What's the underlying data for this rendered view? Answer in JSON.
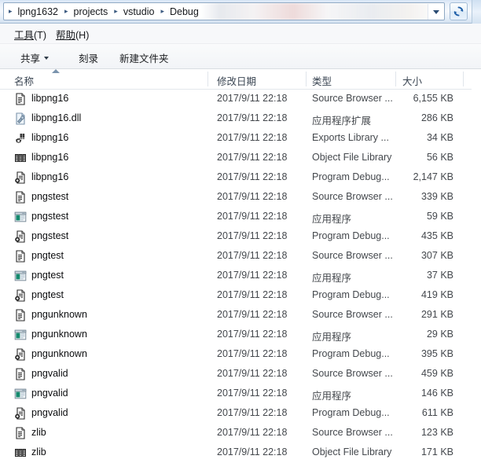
{
  "address_bar": {
    "breadcrumbs": [
      "lpng1632",
      "projects",
      "vstudio",
      "Debug"
    ],
    "separator_icon": "chevron-right-icon",
    "dropdown_icon": "chevron-down-icon",
    "refresh_icon": "refresh-icon"
  },
  "menubar": {
    "items": [
      {
        "label": "工具(T)",
        "mnemonic": "工具",
        "suffix": "(T)"
      },
      {
        "label": "帮助(H)",
        "mnemonic": "帮助",
        "suffix": "(H)"
      }
    ]
  },
  "toolbar": {
    "items": [
      {
        "label": "共享",
        "has_caret": true
      },
      {
        "label": "刻录",
        "has_caret": false
      },
      {
        "label": "新建文件夹",
        "has_caret": false
      }
    ]
  },
  "columns": [
    {
      "key": "name",
      "label": "名称",
      "sorted": true,
      "sort_direction": "asc"
    },
    {
      "key": "date",
      "label": "修改日期",
      "sorted": false
    },
    {
      "key": "type",
      "label": "类型",
      "sorted": false
    },
    {
      "key": "size",
      "label": "大小",
      "sorted": false
    }
  ],
  "files": [
    {
      "name": "libpng16",
      "date": "2017/9/11 22:18",
      "type": "Source Browser ...",
      "size": "6,155 KB",
      "icon": "document-file-icon"
    },
    {
      "name": "libpng16.dll",
      "date": "2017/9/11 22:18",
      "type": "应用程序扩展",
      "size": "286 KB",
      "icon": "dll-file-icon"
    },
    {
      "name": "libpng16",
      "date": "2017/9/11 22:18",
      "type": "Exports Library ...",
      "size": "34 KB",
      "icon": "exports-library-icon"
    },
    {
      "name": "libpng16",
      "date": "2017/9/11 22:18",
      "type": "Object File Library",
      "size": "56 KB",
      "icon": "object-library-icon"
    },
    {
      "name": "libpng16",
      "date": "2017/9/11 22:18",
      "type": "Program Debug...",
      "size": "2,147 KB",
      "icon": "pdb-file-icon"
    },
    {
      "name": "pngstest",
      "date": "2017/9/11 22:18",
      "type": "Source Browser ...",
      "size": "339 KB",
      "icon": "document-file-icon"
    },
    {
      "name": "pngstest",
      "date": "2017/9/11 22:18",
      "type": "应用程序",
      "size": "59 KB",
      "icon": "application-exe-icon"
    },
    {
      "name": "pngstest",
      "date": "2017/9/11 22:18",
      "type": "Program Debug...",
      "size": "435 KB",
      "icon": "pdb-file-icon"
    },
    {
      "name": "pngtest",
      "date": "2017/9/11 22:18",
      "type": "Source Browser ...",
      "size": "307 KB",
      "icon": "document-file-icon"
    },
    {
      "name": "pngtest",
      "date": "2017/9/11 22:18",
      "type": "应用程序",
      "size": "37 KB",
      "icon": "application-exe-icon"
    },
    {
      "name": "pngtest",
      "date": "2017/9/11 22:18",
      "type": "Program Debug...",
      "size": "419 KB",
      "icon": "pdb-file-icon"
    },
    {
      "name": "pngunknown",
      "date": "2017/9/11 22:18",
      "type": "Source Browser ...",
      "size": "291 KB",
      "icon": "document-file-icon"
    },
    {
      "name": "pngunknown",
      "date": "2017/9/11 22:18",
      "type": "应用程序",
      "size": "29 KB",
      "icon": "application-exe-icon"
    },
    {
      "name": "pngunknown",
      "date": "2017/9/11 22:18",
      "type": "Program Debug...",
      "size": "395 KB",
      "icon": "pdb-file-icon"
    },
    {
      "name": "pngvalid",
      "date": "2017/9/11 22:18",
      "type": "Source Browser ...",
      "size": "459 KB",
      "icon": "document-file-icon"
    },
    {
      "name": "pngvalid",
      "date": "2017/9/11 22:18",
      "type": "应用程序",
      "size": "146 KB",
      "icon": "application-exe-icon"
    },
    {
      "name": "pngvalid",
      "date": "2017/9/11 22:18",
      "type": "Program Debug...",
      "size": "611 KB",
      "icon": "pdb-file-icon"
    },
    {
      "name": "zlib",
      "date": "2017/9/11 22:18",
      "type": "Source Browser ...",
      "size": "123 KB",
      "icon": "document-file-icon"
    },
    {
      "name": "zlib",
      "date": "2017/9/11 22:18",
      "type": "Object File Library",
      "size": "171 KB",
      "icon": "object-library-icon"
    }
  ],
  "colors": {
    "accent": "#2a4c73",
    "header_text": "#3b4653",
    "row_text": "#0c0d0f",
    "secondary_text": "#44484d",
    "chrome": "#e9f1fa"
  }
}
